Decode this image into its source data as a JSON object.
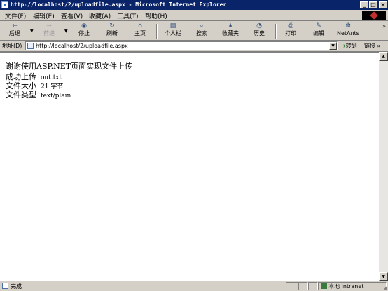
{
  "window": {
    "title": "http://localhost/2/uploadfile.aspx - Microsoft Internet Explorer",
    "minimize": "_",
    "maximize": "□",
    "close": "×"
  },
  "menu": {
    "file": "文件(F)",
    "edit": "编辑(E)",
    "view": "查看(V)",
    "favorites": "收藏(A)",
    "tools": "工具(T)",
    "help": "帮助(H)"
  },
  "toolbar": {
    "back": "后退",
    "forward": "前进",
    "stop": "停止",
    "refresh": "刷新",
    "home": "主页",
    "personal": "个人栏",
    "search": "搜索",
    "favorites": "收藏夹",
    "history": "历史",
    "print": "打印",
    "edit": "编辑",
    "netants": "NetAnts",
    "more": "»"
  },
  "icons": {
    "back": "⇐",
    "forward": "⇒",
    "stop": "◉",
    "refresh": "↻",
    "home": "⌂",
    "personal": "▤",
    "search": "⌕",
    "favorites": "★",
    "history": "◔",
    "print": "⎙",
    "edit": "✎",
    "netants": "✲"
  },
  "address": {
    "label": "地址(D)",
    "url": "http://localhost/2/uploadfile.aspx",
    "go": "转到",
    "links": "链接 »"
  },
  "page": {
    "heading": "谢谢使用ASP.NET页面实现文件上传",
    "rows": [
      {
        "label": "成功上传",
        "value": "out.txt"
      },
      {
        "label": "文件大小",
        "value": "21 字节"
      },
      {
        "label": "文件类型",
        "value": "text/plain"
      }
    ]
  },
  "status": {
    "text": "完成",
    "zone": "本地 Intranet"
  },
  "colors": {
    "titlebar": "#0a246a",
    "chrome": "#d4d0c8"
  }
}
